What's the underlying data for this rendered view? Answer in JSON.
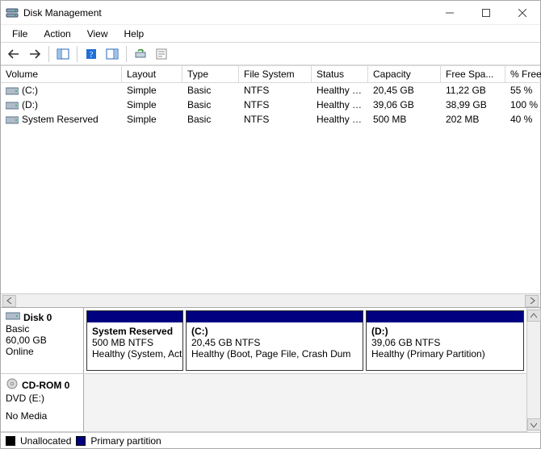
{
  "window": {
    "title": "Disk Management"
  },
  "menu": {
    "file": "File",
    "action": "Action",
    "view": "View",
    "help": "Help"
  },
  "columns": {
    "volume": "Volume",
    "layout": "Layout",
    "type": "Type",
    "filesystem": "File System",
    "status": "Status",
    "capacity": "Capacity",
    "freespace": "Free Spa...",
    "pctfree": "% Free"
  },
  "volumes": [
    {
      "name": "(C:)",
      "layout": "Simple",
      "type": "Basic",
      "fs": "NTFS",
      "status": "Healthy (B...",
      "capacity": "20,45 GB",
      "free": "11,22 GB",
      "pct": "55 %"
    },
    {
      "name": "(D:)",
      "layout": "Simple",
      "type": "Basic",
      "fs": "NTFS",
      "status": "Healthy (P...",
      "capacity": "39,06 GB",
      "free": "38,99 GB",
      "pct": "100 %"
    },
    {
      "name": "System Reserved",
      "layout": "Simple",
      "type": "Basic",
      "fs": "NTFS",
      "status": "Healthy (S...",
      "capacity": "500 MB",
      "free": "202 MB",
      "pct": "40 %"
    }
  ],
  "disk0": {
    "title": "Disk 0",
    "type": "Basic",
    "size": "60,00 GB",
    "state": "Online",
    "parts": [
      {
        "title": "System Reserved",
        "line2": "500 MB NTFS",
        "line3": "Healthy (System, Act"
      },
      {
        "title": "(C:)",
        "line2": "20,45 GB NTFS",
        "line3": "Healthy (Boot, Page File, Crash Dum"
      },
      {
        "title": "(D:)",
        "line2": "39,06 GB NTFS",
        "line3": "Healthy (Primary Partition)"
      }
    ]
  },
  "cdrom": {
    "title": "CD-ROM 0",
    "line2": "DVD (E:)",
    "line3": "No Media"
  },
  "legend": {
    "unalloc": "Unallocated",
    "primary": "Primary partition"
  }
}
